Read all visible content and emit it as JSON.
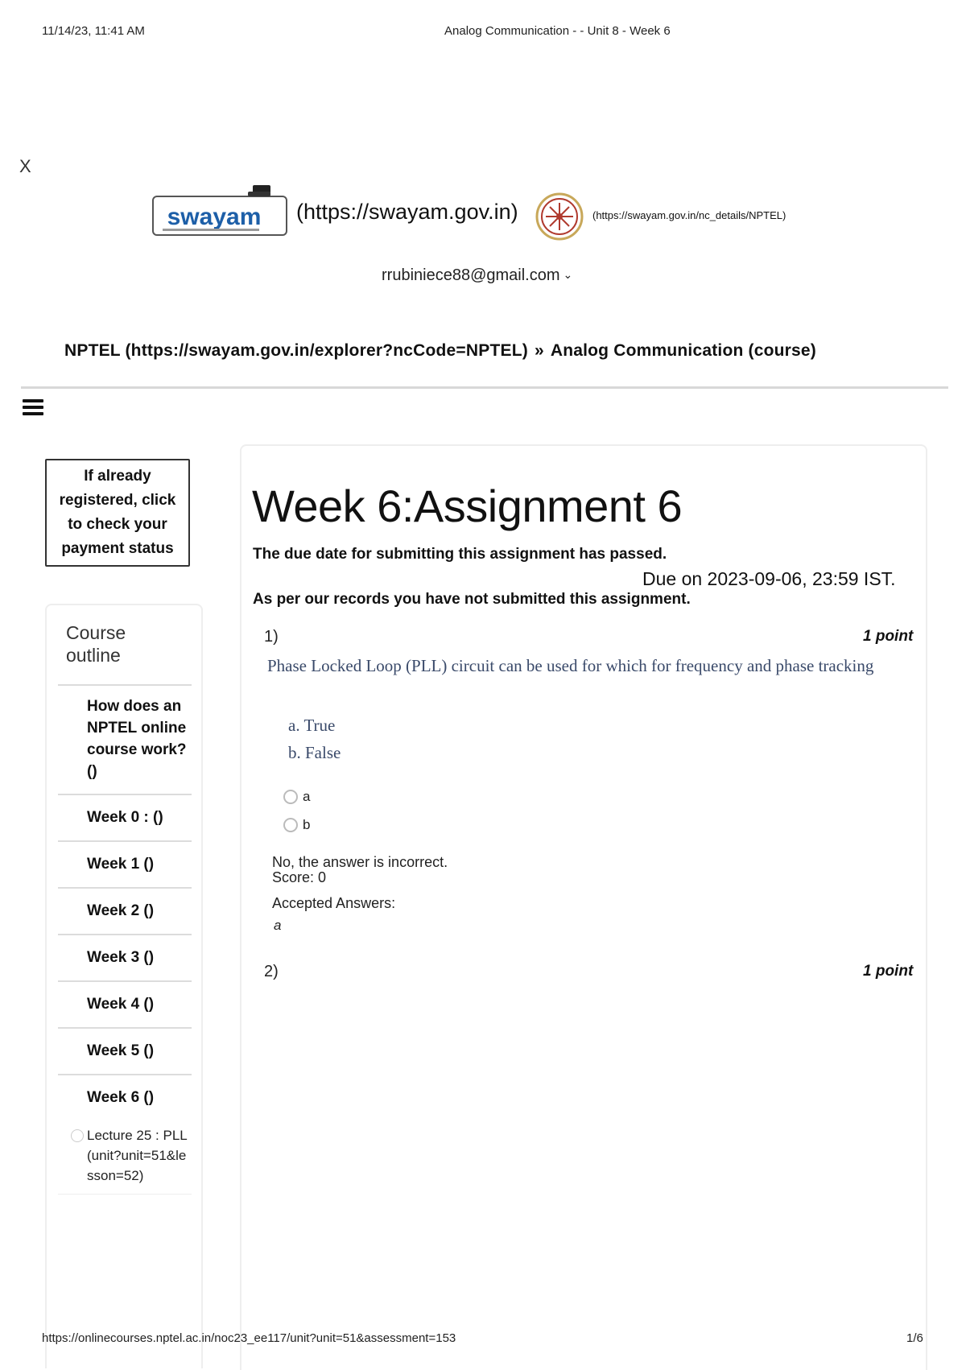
{
  "print_header": {
    "datetime": "11/14/23, 11:41 AM",
    "title": "Analog Communication - - Unit 8 - Week 6"
  },
  "close_label": "X",
  "logos": {
    "swayam_link": "(https://swayam.gov.in)",
    "nptel_link": "(https://swayam.gov.in/nc_details/NPTEL)"
  },
  "user": {
    "email": "rrubiniece88@gmail.com"
  },
  "breadcrumb": {
    "part1": "NPTEL (https://swayam.gov.in/explorer?ncCode=NPTEL)",
    "separator": "»",
    "part2": "Analog Communication (course)"
  },
  "sidebar": {
    "payment_status": "If already registered, click to check your payment status",
    "outline_title": "Course outline",
    "items": [
      "How does an NPTEL online course work? ()",
      "Week 0 : ()",
      "Week 1 ()",
      "Week 2 ()",
      "Week 3 ()",
      "Week 4 ()",
      "Week 5 ()",
      "Week 6 ()"
    ],
    "lecture": "Lecture 25 : PLL (unit?unit=51&lesson=52)"
  },
  "assignment": {
    "title": "Week 6:Assignment 6",
    "due_passed": "The due date for submitting this assignment has passed.",
    "due_date": "Due on 2023-09-06, 23:59 IST.",
    "not_submitted": "As per our records you have not submitted this assignment."
  },
  "questions": [
    {
      "number": "1)",
      "points": "1 point",
      "text": "Phase Locked Loop (PLL) circuit can be used for which for frequency and phase tracking",
      "options_text": [
        "a. True",
        "b. False"
      ],
      "radio_options": [
        "a",
        "b"
      ],
      "feedback": "No, the answer is incorrect.",
      "score": "Score: 0",
      "accepted_label": "Accepted Answers:",
      "accepted_value": "a"
    },
    {
      "number": "2)",
      "points": "1 point"
    }
  ],
  "footer": {
    "url": "https://onlinecourses.nptel.ac.in/noc23_ee117/unit?unit=51&assessment=153",
    "page": "1/6"
  },
  "colors": {
    "question_text": "#3a4a6a",
    "swayam_blue": "#1d5fa8",
    "nptel_red": "#b03a2e",
    "divider": "#d8d8d8"
  }
}
